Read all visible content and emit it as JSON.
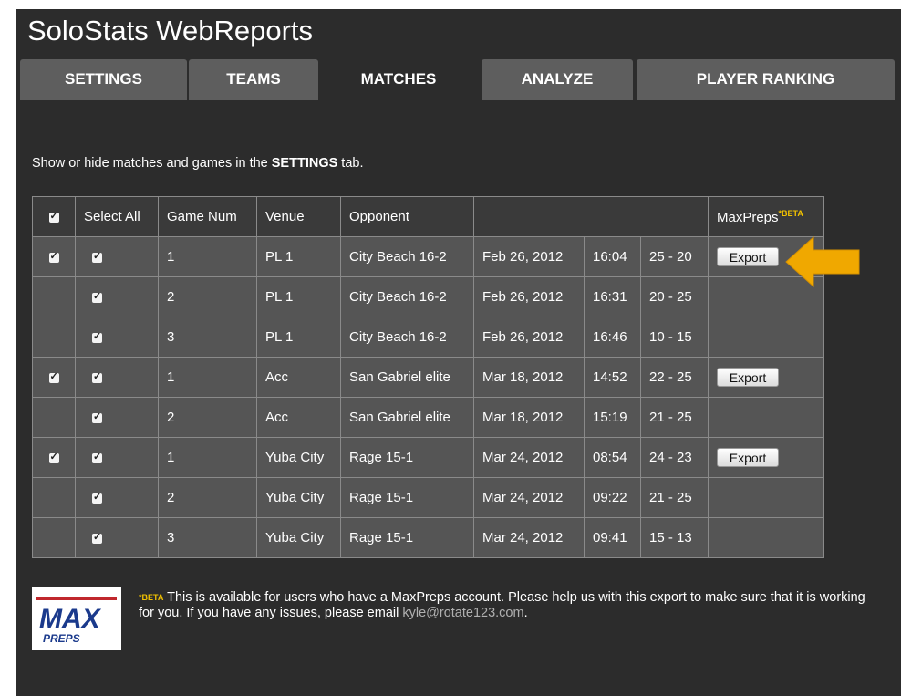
{
  "app": {
    "title": "SoloStats WebReports"
  },
  "tabs": [
    {
      "label": "SETTINGS",
      "active": false
    },
    {
      "label": "TEAMS",
      "active": false
    },
    {
      "label": "MATCHES",
      "active": true
    },
    {
      "label": "ANALYZE",
      "active": false
    },
    {
      "label": "PLAYER RANKING",
      "active": false
    }
  ],
  "hint": {
    "prefix": "Show or hide matches and games in the ",
    "bold": "SETTINGS",
    "suffix": " tab."
  },
  "table": {
    "headers": {
      "select_all": "Select All",
      "game_num": "Game Num",
      "venue": "Venue",
      "opponent": "Opponent",
      "maxpreps": "MaxPreps",
      "beta": "*BETA"
    },
    "rows": [
      {
        "match_checked": true,
        "game": "1",
        "venue": "PL 1",
        "opponent": "City Beach 16-2",
        "date": "Feb 26, 2012",
        "time": "16:04",
        "score": "25 - 20",
        "export": "Export"
      },
      {
        "match_checked": false,
        "game": "2",
        "venue": "PL 1",
        "opponent": "City Beach 16-2",
        "date": "Feb 26, 2012",
        "time": "16:31",
        "score": "20 - 25",
        "export": ""
      },
      {
        "match_checked": false,
        "game": "3",
        "venue": "PL 1",
        "opponent": "City Beach 16-2",
        "date": "Feb 26, 2012",
        "time": "16:46",
        "score": "10 - 15",
        "export": ""
      },
      {
        "match_checked": true,
        "game": "1",
        "venue": "Acc",
        "opponent": "San Gabriel elite",
        "date": "Mar 18, 2012",
        "time": "14:52",
        "score": "22 - 25",
        "export": "Export"
      },
      {
        "match_checked": false,
        "game": "2",
        "venue": "Acc",
        "opponent": "San Gabriel elite",
        "date": "Mar 18, 2012",
        "time": "15:19",
        "score": "21 - 25",
        "export": ""
      },
      {
        "match_checked": true,
        "game": "1",
        "venue": "Yuba City",
        "opponent": "Rage 15-1",
        "date": "Mar 24, 2012",
        "time": "08:54",
        "score": "24 - 23",
        "export": "Export"
      },
      {
        "match_checked": false,
        "game": "2",
        "venue": "Yuba City",
        "opponent": "Rage 15-1",
        "date": "Mar 24, 2012",
        "time": "09:22",
        "score": "21 - 25",
        "export": ""
      },
      {
        "match_checked": false,
        "game": "3",
        "venue": "Yuba City",
        "opponent": "Rage 15-1",
        "date": "Mar 24, 2012",
        "time": "09:41",
        "score": "15 - 13",
        "export": ""
      }
    ]
  },
  "footer": {
    "beta": "*BETA",
    "text": " This is available for users who have a MaxPreps account. Please help us with this export to make sure that it is working for you. If you have any issues, please email ",
    "email": "kyle@rotate123.com",
    "end": "."
  },
  "logo": {
    "name": "maxpreps-logo",
    "text_max": "MAX",
    "text_preps": "PREPS"
  },
  "colors": {
    "background": "#2c2c2c",
    "tab": "#5e5e5e",
    "row": "#555555",
    "beta": "#f2c200",
    "arrow": "#f0a800"
  },
  "icons": {
    "arrow": "arrow-left-icon",
    "checkbox": "checkbox-icon"
  }
}
